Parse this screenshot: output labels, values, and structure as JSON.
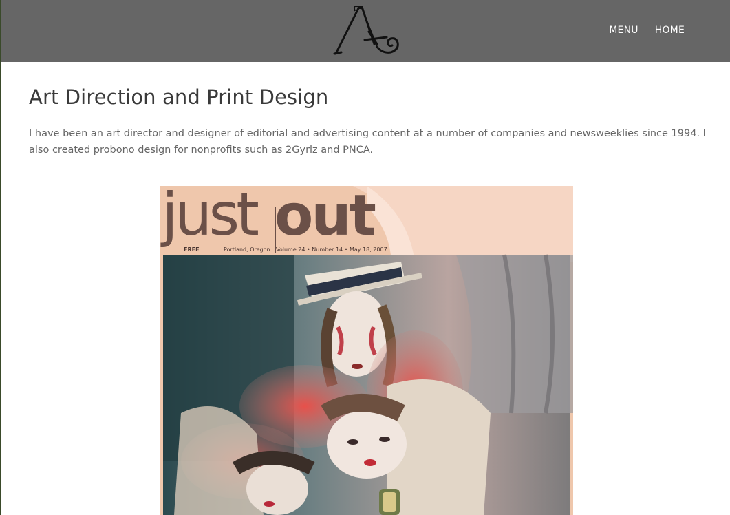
{
  "header": {
    "logo_name": "site-logo",
    "nav": {
      "menu_label": "MENU",
      "home_label": "HOME"
    }
  },
  "main": {
    "title": "Art Direction and Print Design",
    "intro": "I have been an art director and designer of editorial and advertising content at a number of companies and newsweeklies since 1994. I also created probono design for nonprofits such as 2Gyrlz and PNCA."
  },
  "cover": {
    "masthead_just": "just",
    "masthead_out": "out",
    "free_label": "FREE",
    "city": "Portland, Oregon",
    "issue": "Volume 24 • Number 14 • May 18, 2007"
  },
  "colors": {
    "header_bg": "#666666",
    "title": "#3a3a3a",
    "body_text": "#666666",
    "cover_bg": "#efc7ac",
    "masthead": "#6b5048"
  }
}
